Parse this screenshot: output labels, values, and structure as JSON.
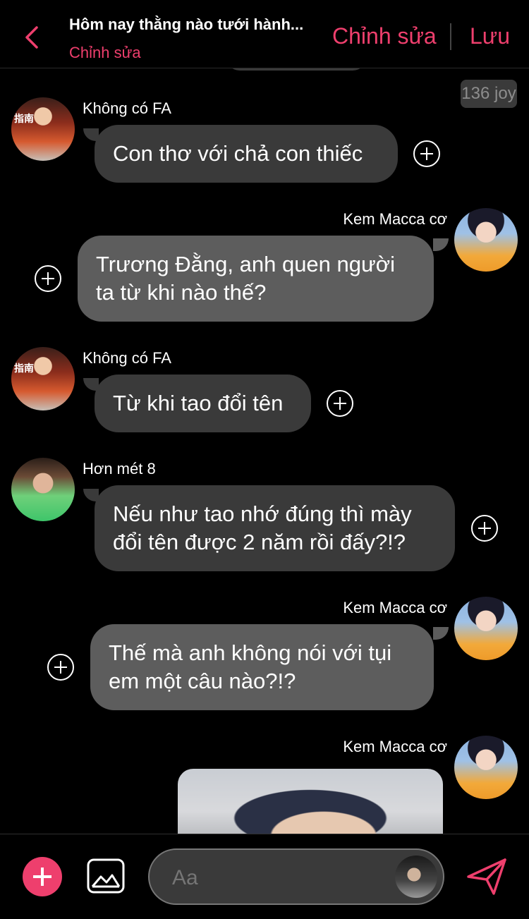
{
  "header": {
    "title": "Hôm nay thằng nào tưới hành...",
    "subtitle": "Chỉnh sửa",
    "edit_label": "Chỉnh sửa",
    "save_label": "Lưu"
  },
  "joy_badge": "136 joy",
  "messages": [
    {
      "sender": "Không có FA",
      "text": "Con thơ với chả con thiếc"
    },
    {
      "sender": "Kem Macca cơ",
      "text_line1": "Trương Đằng, anh quen người",
      "text_line2": "ta từ khi nào thế?"
    },
    {
      "sender": "Không có FA",
      "text": "Từ khi tao đổi tên"
    },
    {
      "sender": "Hơn mét 8",
      "text_line1": "Nếu như tao nhớ đúng thì mày",
      "text_line2": "đổi tên được 2 năm rồi đấy?!?"
    },
    {
      "sender": "Kem Macca cơ",
      "text_line1": "Thế mà anh không nói với tụi",
      "text_line2": "em một câu nào?!?"
    },
    {
      "sender": "Kem Macca cơ"
    }
  ],
  "avatar_left_label": "指南",
  "composer": {
    "placeholder": "Aa"
  },
  "colors": {
    "accent": "#ee3f6d",
    "background": "#000000",
    "bubble_other": "#3a3a3a",
    "bubble_mine": "#5d5d5d"
  },
  "icons": {
    "back": "chevron-left-icon",
    "add": "plus-circle-icon",
    "gallery": "image-icon",
    "send": "send-icon"
  }
}
